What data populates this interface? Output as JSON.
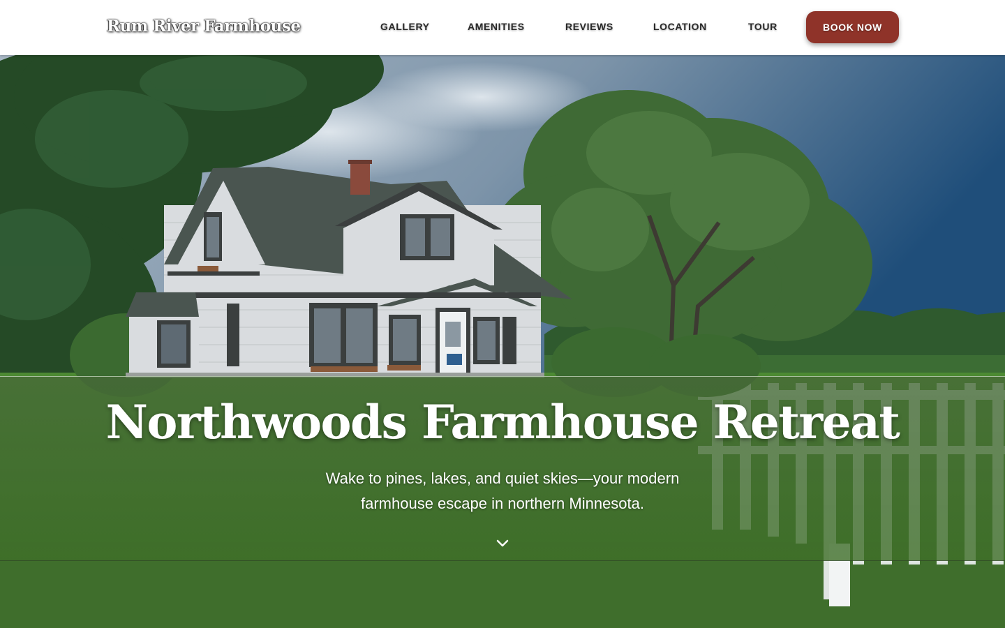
{
  "site": {
    "brand": "Rum River Farmhouse"
  },
  "nav": {
    "items": [
      {
        "label": "GALLERY"
      },
      {
        "label": "AMENITIES"
      },
      {
        "label": "REVIEWS"
      },
      {
        "label": "LOCATION"
      },
      {
        "label": "TOUR"
      }
    ],
    "book_label": "BOOK NOW"
  },
  "hero": {
    "title": "Northwoods Farmhouse Retreat",
    "subtitle": "Wake to pines, lakes, and quiet skies—your modern farmhouse escape in northern Minnesota.",
    "scroll_icon": "chevron-down-icon"
  },
  "colors": {
    "header_bg": "#ffffff",
    "nav_text": "#2a2a2a",
    "book_button": "#8f3329",
    "hero_band": "#4e7a38",
    "house_siding": "#d9dcdf",
    "roof": "#4a5550",
    "trim": "#3b3f3f"
  }
}
